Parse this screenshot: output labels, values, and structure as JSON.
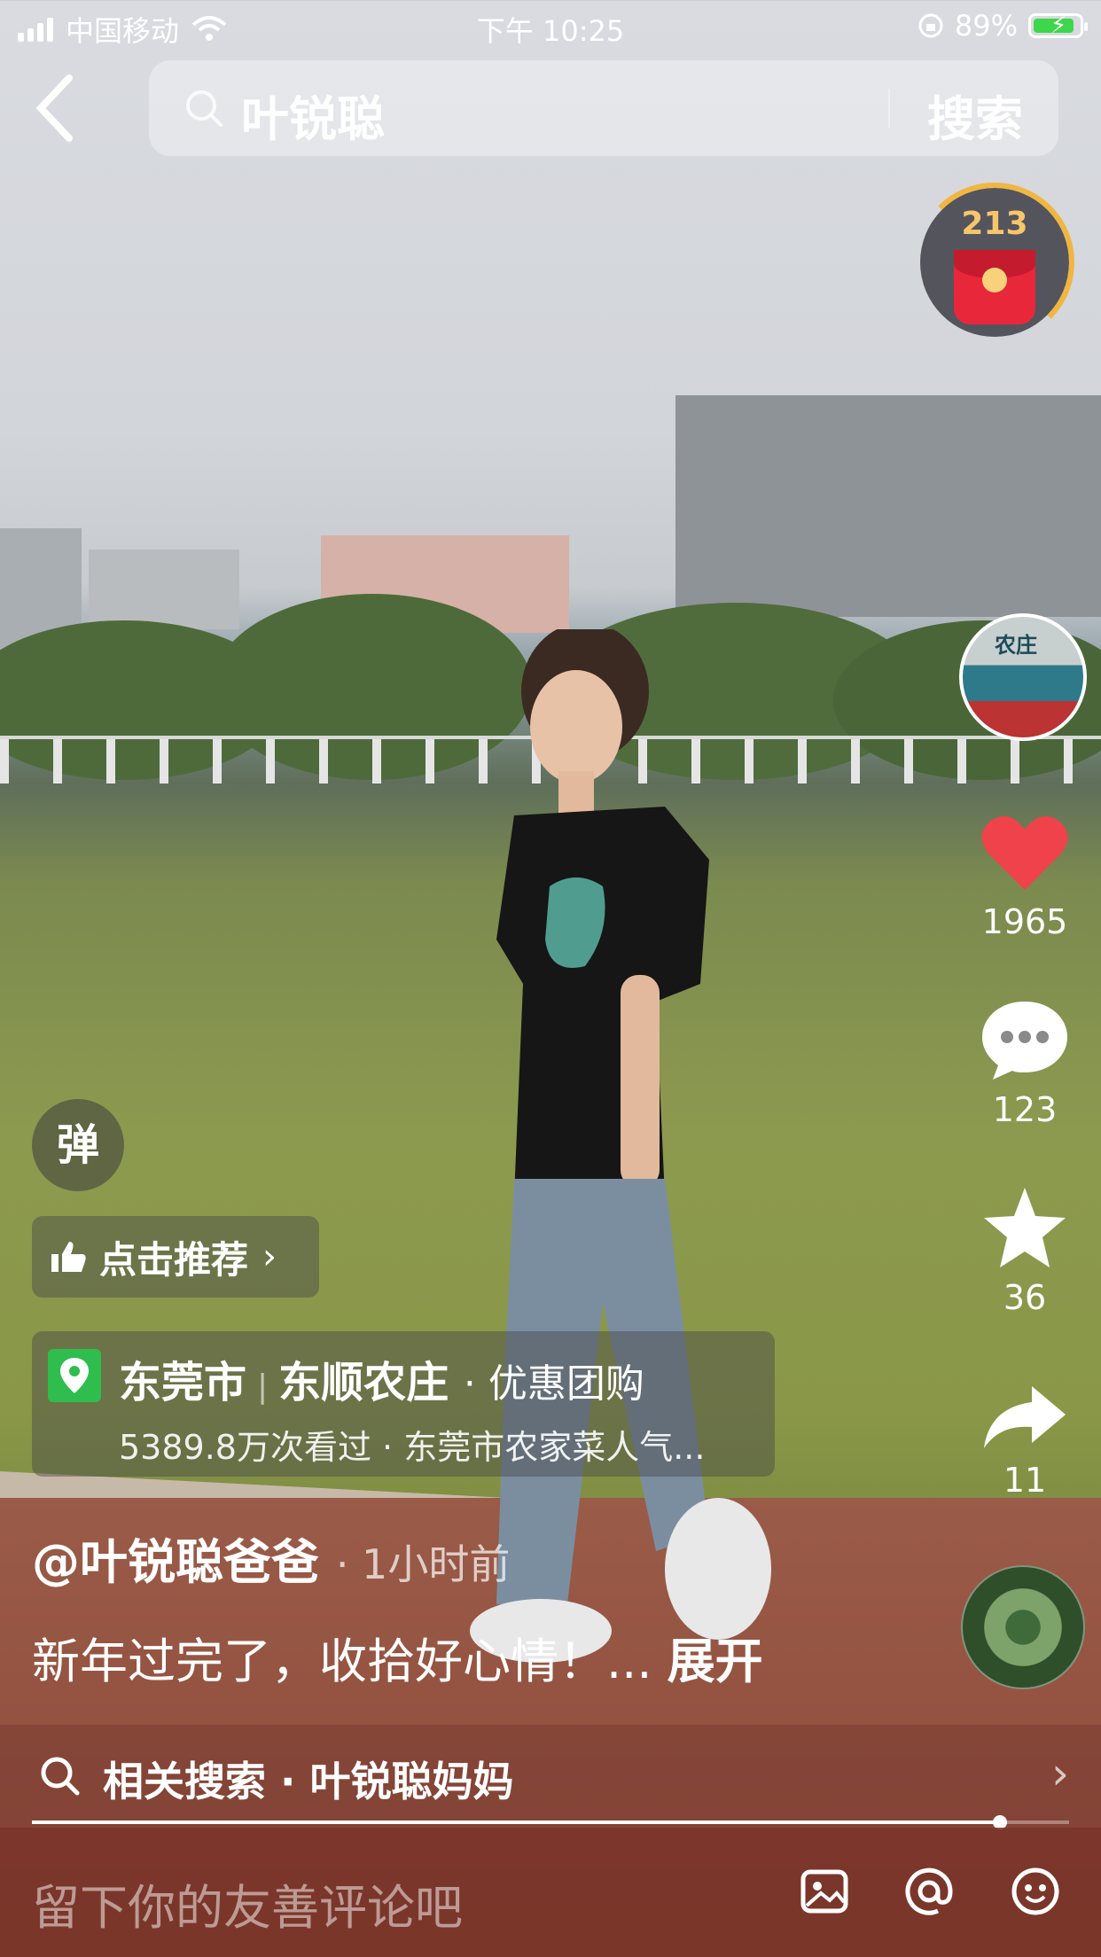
{
  "status_bar": {
    "carrier": "中国移动",
    "time": "下午 10:25",
    "battery": "89%",
    "battery_level": 0.89
  },
  "search": {
    "query": "叶锐聪",
    "button_label": "搜索"
  },
  "red_packet": {
    "count": "213"
  },
  "rail": {
    "avatar_sign": "农庄",
    "likes": "1965",
    "comments": "123",
    "favorites": "36",
    "shares": "11"
  },
  "danmu": {
    "label": "弹"
  },
  "recommend": {
    "label": "点击推荐"
  },
  "poi": {
    "city": "东莞市",
    "place": "东顺农庄",
    "deal": "· 优惠团购",
    "views": "5389.8万次看过 · 东莞市农家菜人气..."
  },
  "post": {
    "author": "@叶锐聪爸爸",
    "time": "· 1小时前",
    "caption": "新年过完了，收拾好心情！...",
    "expand": "展开"
  },
  "related": {
    "text": "相关搜索 · 叶锐聪妈妈"
  },
  "video_progress": 0.933,
  "comment_bar": {
    "placeholder": "留下你的友善评论吧"
  },
  "icons": {
    "accent_like": "#f0424a",
    "poi_pin": "#2fbd4d"
  }
}
